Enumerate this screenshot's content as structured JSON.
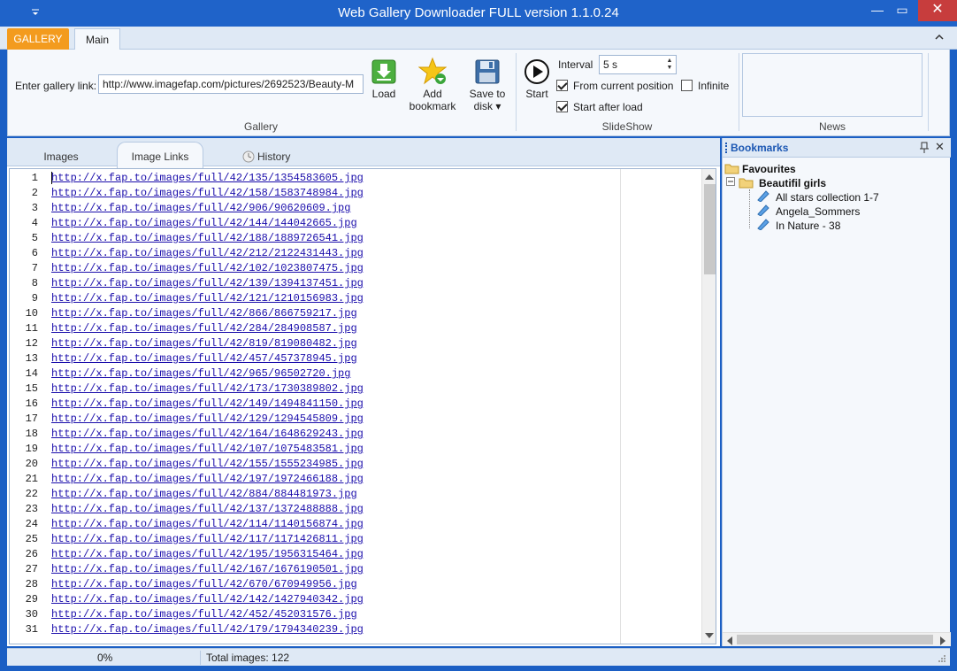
{
  "window": {
    "title": "Web Gallery Downloader FULL version 1.1.0.24",
    "minimize": "—",
    "maximize": "▭",
    "close": "✕"
  },
  "ribbon": {
    "app_tab": "GALLERY",
    "main_tab": "Main",
    "gallery": {
      "label": "Enter gallery link:",
      "link_value": "http://www.imagefap.com/pictures/2692523/Beauty-M",
      "load": "Load",
      "add_bookmark_line1": "Add",
      "add_bookmark_line2": "bookmark",
      "save_line1": "Save to",
      "save_line2": "disk ▾",
      "caption": "Gallery"
    },
    "slideshow": {
      "start": "Start",
      "interval_label": "Interval",
      "interval_value": "5 s",
      "from_current_position": "From current position",
      "from_current_checked": true,
      "infinite": "Infinite",
      "infinite_checked": false,
      "start_after_load": "Start after load",
      "start_after_load_checked": true,
      "caption": "SlideShow"
    },
    "news": {
      "caption": "News"
    }
  },
  "doc_tabs": {
    "images": "Images",
    "image_links": "Image Links",
    "history": "History",
    "active": "image_links"
  },
  "links": [
    "http://x.fap.to/images/full/42/135/1354583605.jpg",
    "http://x.fap.to/images/full/42/158/1583748984.jpg",
    "http://x.fap.to/images/full/42/906/90620609.jpg",
    "http://x.fap.to/images/full/42/144/144042665.jpg",
    "http://x.fap.to/images/full/42/188/1889726541.jpg",
    "http://x.fap.to/images/full/42/212/2122431443.jpg",
    "http://x.fap.to/images/full/42/102/1023807475.jpg",
    "http://x.fap.to/images/full/42/139/1394137451.jpg",
    "http://x.fap.to/images/full/42/121/1210156983.jpg",
    "http://x.fap.to/images/full/42/866/866759217.jpg",
    "http://x.fap.to/images/full/42/284/284908587.jpg",
    "http://x.fap.to/images/full/42/819/819080482.jpg",
    "http://x.fap.to/images/full/42/457/457378945.jpg",
    "http://x.fap.to/images/full/42/965/96502720.jpg",
    "http://x.fap.to/images/full/42/173/1730389802.jpg",
    "http://x.fap.to/images/full/42/149/1494841150.jpg",
    "http://x.fap.to/images/full/42/129/1294545809.jpg",
    "http://x.fap.to/images/full/42/164/1648629243.jpg",
    "http://x.fap.to/images/full/42/107/1075483581.jpg",
    "http://x.fap.to/images/full/42/155/1555234985.jpg",
    "http://x.fap.to/images/full/42/197/1972466188.jpg",
    "http://x.fap.to/images/full/42/884/884481973.jpg",
    "http://x.fap.to/images/full/42/137/1372488888.jpg",
    "http://x.fap.to/images/full/42/114/1140156874.jpg",
    "http://x.fap.to/images/full/42/117/1171426811.jpg",
    "http://x.fap.to/images/full/42/195/1956315464.jpg",
    "http://x.fap.to/images/full/42/167/1676190501.jpg",
    "http://x.fap.to/images/full/42/670/670949956.jpg",
    "http://x.fap.to/images/full/42/142/1427940342.jpg",
    "http://x.fap.to/images/full/42/452/452031576.jpg",
    "http://x.fap.to/images/full/42/179/1794340239.jpg"
  ],
  "bookmarks": {
    "title": "Bookmarks",
    "pin": "📌",
    "close": "✕",
    "root": "Favourites",
    "folder": "Beautifil girls",
    "items": [
      "All stars collection 1-7",
      "Angela_Sommers",
      "In Nature - 38"
    ]
  },
  "status": {
    "progress": "0%",
    "total": "Total images: 122"
  },
  "colors": {
    "titlebar": "#1f63c9",
    "app_tab": "#f39b1e",
    "link": "#1a0dab",
    "accent_title": "#1b57b3"
  },
  "icons": {
    "load": "download-arrow-icon",
    "add_bookmark": "star-add-icon",
    "save": "floppy-disk-icon",
    "start": "play-circle-icon",
    "history": "clock-icon",
    "bookmark_item": "bookmark-pencil-icon",
    "folder": "folder-icon"
  }
}
